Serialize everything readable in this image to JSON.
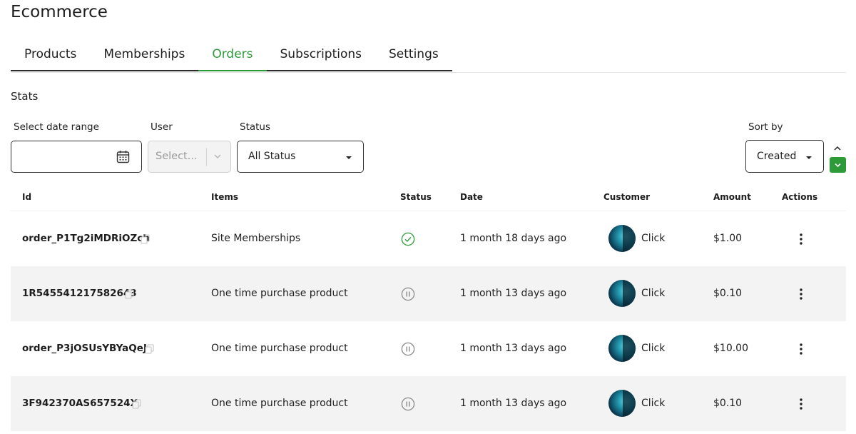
{
  "page_title": "Ecommerce",
  "tabs": [
    {
      "label": "Products"
    },
    {
      "label": "Memberships"
    },
    {
      "label": "Orders"
    },
    {
      "label": "Subscriptions"
    },
    {
      "label": "Settings"
    }
  ],
  "active_tab": "Orders",
  "section_label": "Stats",
  "filters": {
    "date_range_label": "Select date range",
    "date_range_value": "",
    "user_label": "User",
    "user_placeholder": "Select...",
    "status_label": "Status",
    "status_value": "All Status",
    "sort_label": "Sort by",
    "sort_value": "Created"
  },
  "table": {
    "columns": [
      "Id",
      "Items",
      "Status",
      "Date",
      "Customer",
      "Amount",
      "Actions"
    ],
    "rows": [
      {
        "id": "order_P1Tg2iMDRiOZch",
        "items": "Site Memberships",
        "status_icon": "check-circle-icon",
        "date": "1 month 18 days ago",
        "customer": "Click",
        "amount": "$1.00"
      },
      {
        "id": "1R545541217582643",
        "items": "One time purchase product",
        "status_icon": "pause-circle-icon",
        "date": "1 month 13 days ago",
        "customer": "Click",
        "amount": "$0.10"
      },
      {
        "id": "order_P3jOSUsYBYaQeJ",
        "items": "One time purchase product",
        "status_icon": "pause-circle-icon",
        "date": "1 month 13 days ago",
        "customer": "Click",
        "amount": "$10.00"
      },
      {
        "id": "3F942370AS657524X",
        "items": "One time purchase product",
        "status_icon": "pause-circle-icon",
        "date": "1 month 13 days ago",
        "customer": "Click",
        "amount": "$0.10"
      }
    ]
  },
  "colors": {
    "accent": "#2e9b3a",
    "text": "#1e1e1e",
    "row_alt": "#f3f3f3",
    "border": "#333333"
  }
}
